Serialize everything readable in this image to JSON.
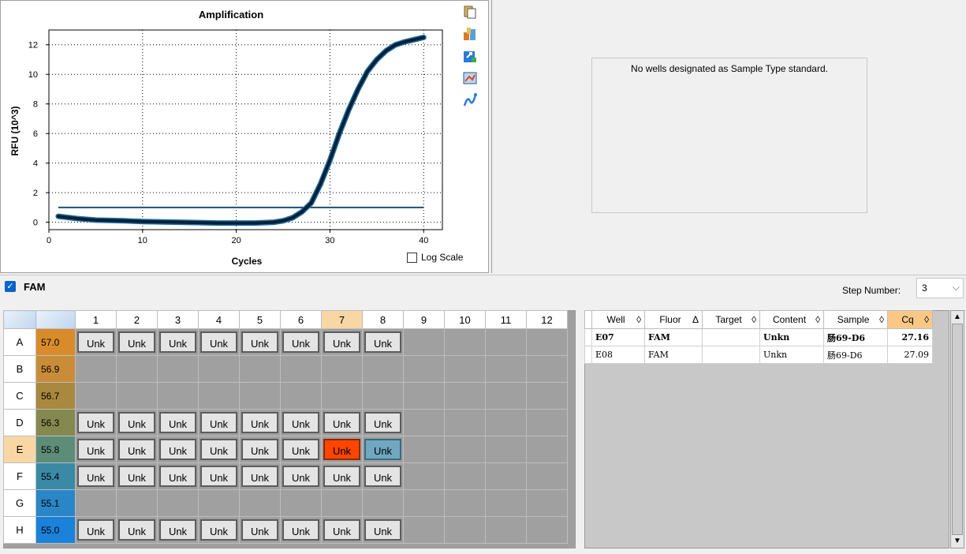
{
  "chart": {
    "title": "Amplification",
    "xlabel": "Cycles",
    "ylabel": "RFU (10^3)",
    "log_scale_label": "Log Scale"
  },
  "chart_data": {
    "type": "line",
    "title": "Amplification",
    "xlabel": "Cycles",
    "ylabel": "RFU (10^3)",
    "xlim": [
      0,
      42
    ],
    "ylim": [
      -0.5,
      13
    ],
    "x_ticks": [
      0,
      10,
      20,
      30,
      40
    ],
    "y_ticks": [
      0,
      2,
      4,
      6,
      8,
      10,
      12
    ],
    "grid": true,
    "threshold": 1.0,
    "series": [
      {
        "x": [
          1,
          3,
          5,
          8,
          10,
          14,
          18,
          22,
          24,
          25,
          26,
          27,
          28,
          29,
          30,
          31,
          32,
          33,
          34,
          35,
          36,
          37,
          38,
          39,
          40
        ],
        "y": [
          0.4,
          0.25,
          0.15,
          0.1,
          0.05,
          0.0,
          -0.05,
          -0.05,
          0.0,
          0.1,
          0.3,
          0.7,
          1.3,
          2.6,
          4.2,
          6.0,
          7.6,
          9.0,
          10.2,
          11.0,
          11.6,
          12.0,
          12.2,
          12.35,
          12.5
        ],
        "color": "#0b1f33"
      }
    ]
  },
  "std_message": "No wells designated as Sample Type standard.",
  "fluor": {
    "name": "FAM",
    "checked": true
  },
  "step": {
    "label": "Step Number:",
    "value": "3"
  },
  "plate": {
    "columns": [
      "1",
      "2",
      "3",
      "4",
      "5",
      "6",
      "7",
      "8",
      "9",
      "10",
      "11",
      "12"
    ],
    "rows": [
      {
        "label": "A",
        "temp": "57.0",
        "color": "#d98b2a",
        "wells": [
          "Unk",
          "Unk",
          "Unk",
          "Unk",
          "Unk",
          "Unk",
          "Unk",
          "Unk",
          "",
          "",
          "",
          ""
        ]
      },
      {
        "label": "B",
        "temp": "56.9",
        "color": "#c98d3a",
        "wells": [
          "",
          "",
          "",
          "",
          "",
          "",
          "",
          "",
          "",
          "",
          "",
          ""
        ]
      },
      {
        "label": "C",
        "temp": "56.7",
        "color": "#a8893d",
        "wells": [
          "",
          "",
          "",
          "",
          "",
          "",
          "",
          "",
          "",
          "",
          "",
          ""
        ]
      },
      {
        "label": "D",
        "temp": "56.3",
        "color": "#86894f",
        "wells": [
          "Unk",
          "Unk",
          "Unk",
          "Unk",
          "Unk",
          "Unk",
          "Unk",
          "Unk",
          "",
          "",
          "",
          ""
        ]
      },
      {
        "label": "E",
        "temp": "55.8",
        "color": "#5d8d79",
        "wells": [
          "Unk",
          "Unk",
          "Unk",
          "Unk",
          "Unk",
          "Unk",
          "Unk",
          "Unk",
          "",
          "",
          "",
          ""
        ]
      },
      {
        "label": "F",
        "temp": "55.4",
        "color": "#3a8aa6",
        "wells": [
          "Unk",
          "Unk",
          "Unk",
          "Unk",
          "Unk",
          "Unk",
          "Unk",
          "Unk",
          "",
          "",
          "",
          ""
        ]
      },
      {
        "label": "G",
        "temp": "55.1",
        "color": "#2a86c6",
        "wells": [
          "",
          "",
          "",
          "",
          "",
          "",
          "",
          "",
          "",
          "",
          "",
          ""
        ]
      },
      {
        "label": "H",
        "temp": "55.0",
        "color": "#1a82da",
        "wells": [
          "Unk",
          "Unk",
          "Unk",
          "Unk",
          "Unk",
          "Unk",
          "Unk",
          "Unk",
          "",
          "",
          "",
          ""
        ]
      }
    ]
  },
  "table": {
    "headers": [
      {
        "label": "Well",
        "sort": "◊"
      },
      {
        "label": "Fluor",
        "sort": "Δ"
      },
      {
        "label": "Target",
        "sort": "◊"
      },
      {
        "label": "Content",
        "sort": "◊"
      },
      {
        "label": "Sample",
        "sort": "◊"
      },
      {
        "label": "Cq",
        "sort": "◊"
      }
    ],
    "rows": [
      {
        "well": "E07",
        "fluor": "FAM",
        "target": "",
        "content": "Unkn",
        "sample": "肠69-D6",
        "cq": "27.16"
      },
      {
        "well": "E08",
        "fluor": "FAM",
        "target": "",
        "content": "Unkn",
        "sample": "肠69-D6",
        "cq": "27.09"
      }
    ]
  }
}
